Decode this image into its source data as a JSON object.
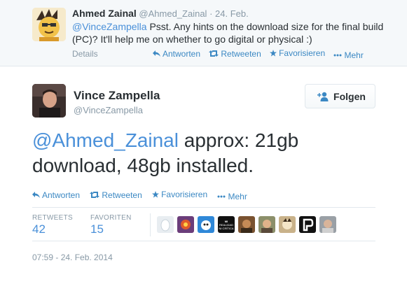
{
  "parent": {
    "name": "Ahmed Zainal",
    "handle": "@Ahmed_Zainal",
    "date": "· 24. Feb.",
    "mention": "@VinceZampella",
    "text": " Psst. Any hints on the download size for the final build (PC)? It'll help me on whether to go digital or physical :)",
    "details_label": "Details",
    "actions": {
      "reply": "Antworten",
      "retweet": "Retweeten",
      "favorite": "Favorisieren",
      "more": "Mehr"
    }
  },
  "tweet": {
    "name": "Vince Zampella",
    "handle": "@VinceZampella",
    "follow_label": "Folgen",
    "mention": "@Ahmed_Zainal",
    "text": " approx: 21gb download, 48gb installed.",
    "actions": {
      "reply": "Antworten",
      "retweet": "Retweeten",
      "favorite": "Favorisieren",
      "more": "Mehr"
    },
    "stats": {
      "retweets_label": "RETWEETS",
      "retweets": "42",
      "favorites_label": "FAVORITEN",
      "favorites": "15"
    },
    "favoriter_overlay_text": "MI REALIDAD NI CRÍTICA",
    "timestamp": "07:59 - 24. Feb. 2014"
  },
  "colors": {
    "link": "#4a90d9",
    "action": "#3b88c3",
    "muted": "#8899a6",
    "text": "#292f33"
  },
  "icons": [
    "reply-icon",
    "retweet-icon",
    "favorite-icon",
    "more-icon",
    "follow-user-icon"
  ]
}
